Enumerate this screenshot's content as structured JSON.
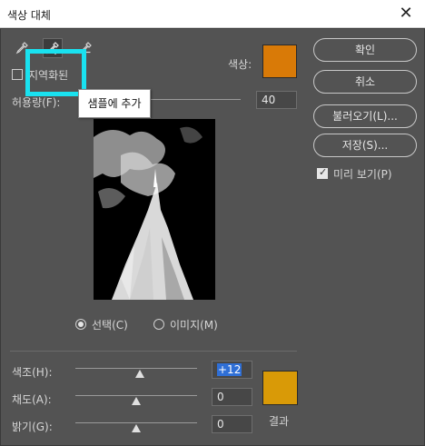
{
  "window": {
    "title": "색상 대체",
    "close_glyph": "✕"
  },
  "tools": {
    "eyedropper_icon": "eyedropper-icon",
    "add_eyedropper_icon": "eyedropper-plus-icon",
    "subtract_eyedropper_icon": "eyedropper-minus-icon"
  },
  "tooltip": "샘플에 추가",
  "selection": {
    "localized_label": "지역화된",
    "color_label": "색상:",
    "color_swatch": "#d97a07",
    "tolerance_label": "허용량(F):",
    "tolerance_value": "40",
    "tolerance_level": 0.31
  },
  "view": {
    "selection_label": "선택(C)",
    "image_label": "이미지(M)",
    "selected": "selection"
  },
  "buttons": {
    "ok": "확인",
    "cancel": "취소",
    "load": "불러오기(L)...",
    "save": "저장(S)..."
  },
  "preview_option": {
    "label": "미리 보기(P)",
    "checked": true
  },
  "replacement": {
    "hue_label": "색조(H):",
    "hue_value": "+12",
    "hue_level": 0.53,
    "saturation_label": "채도(A):",
    "saturation_value": "0",
    "saturation_level": 0.5,
    "lightness_label": "밝기(G):",
    "lightness_value": "0",
    "lightness_level": 0.5,
    "result_label": "결과",
    "result_swatch": "#d99a07"
  }
}
